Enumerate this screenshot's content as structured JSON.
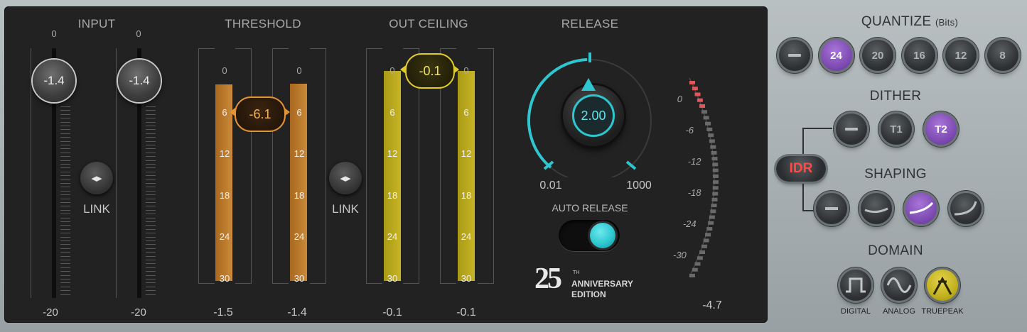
{
  "input": {
    "header": "INPUT",
    "top_left": "0",
    "top_right": "0",
    "knob_left": "-1.4",
    "knob_right": "-1.4",
    "link": "LINK",
    "bottom_left": "-20",
    "bottom_right": "-20"
  },
  "threshold": {
    "header": "THRESHOLD",
    "knob": "-6.1",
    "scale": [
      "0",
      "6",
      "12",
      "18",
      "24",
      "30"
    ],
    "link": "LINK",
    "bottom_left": "-1.5",
    "bottom_right": "-1.4",
    "bar_color": "#c27f30"
  },
  "out_ceiling": {
    "header": "OUT CEILING",
    "knob": "-0.1",
    "scale": [
      "0",
      "6",
      "12",
      "18",
      "24",
      "30"
    ],
    "bottom_left": "-0.1",
    "bottom_right": "-0.1",
    "bar_color": "#c2ae22"
  },
  "release": {
    "header": "RELEASE",
    "knob": "2.00",
    "min": "0.01",
    "max": "1000",
    "auto_release": "AUTO RELEASE",
    "accent": "#2ec7d0"
  },
  "meter": {
    "scale": [
      "0",
      "-6",
      "-12",
      "-18",
      "-24",
      "-30"
    ],
    "value": "-4.7"
  },
  "badge": {
    "number": "25",
    "sup": "TH",
    "line1": "ANNIVERSARY",
    "line2": "EDITION"
  },
  "quantize": {
    "header": "QUANTIZE",
    "header_sub": "(Bits)",
    "options": [
      "—",
      "24",
      "20",
      "16",
      "12",
      "8"
    ],
    "selected": "24"
  },
  "dither": {
    "header": "DITHER",
    "options": [
      "—",
      "T1",
      "T2"
    ],
    "selected": "T2"
  },
  "idr": "IDR",
  "shaping": {
    "header": "SHAPING",
    "selected_index": 2
  },
  "domain": {
    "header": "DOMAIN",
    "labels": [
      "DIGITAL",
      "ANALOG",
      "TRUEPEAK"
    ],
    "selected": "TRUEPEAK"
  }
}
